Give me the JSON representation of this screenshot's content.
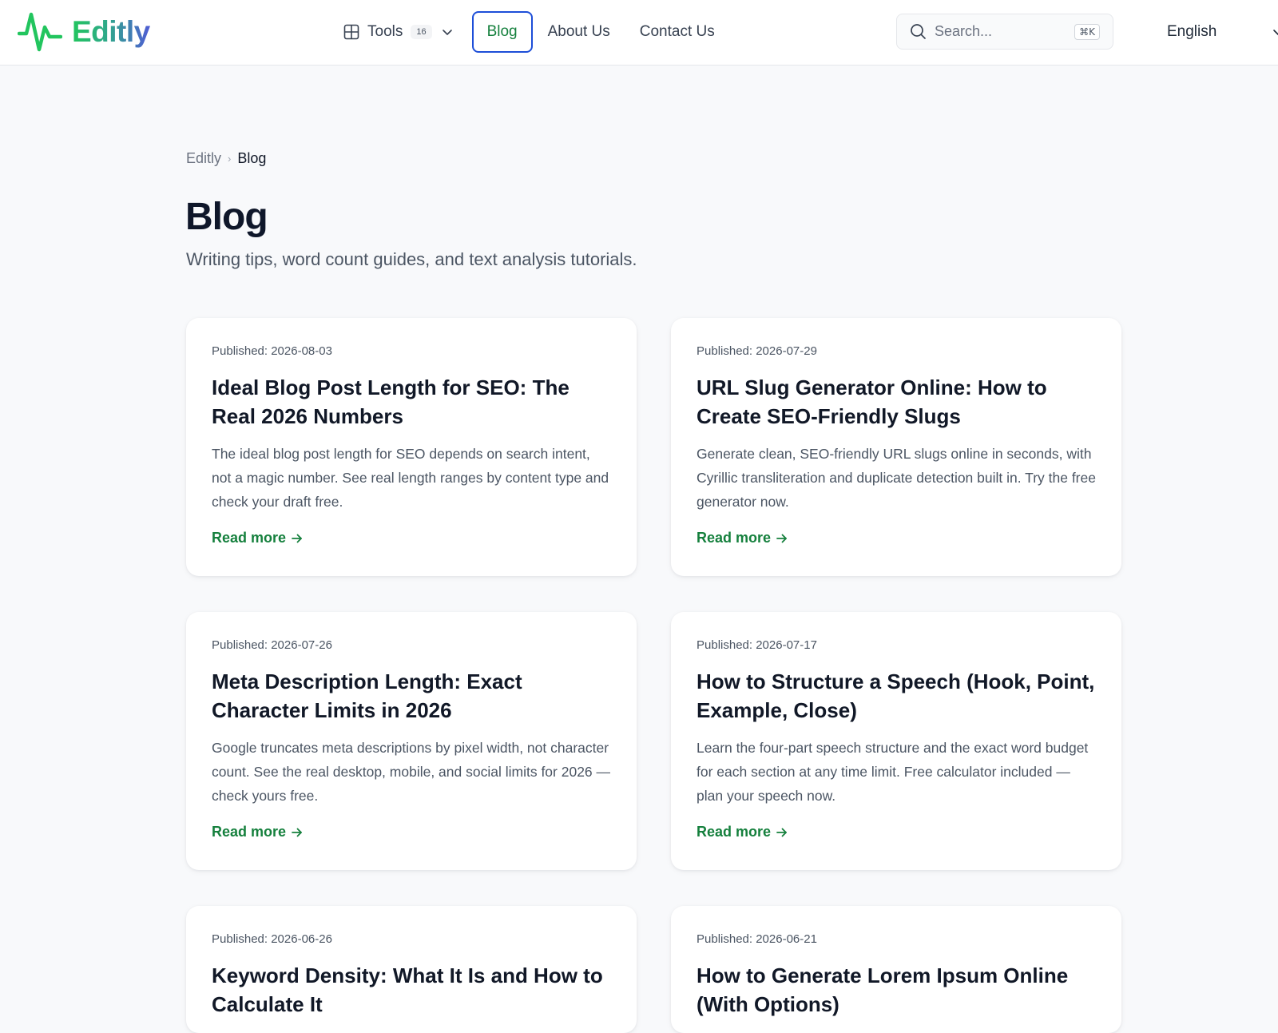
{
  "brand": {
    "name": "Editly",
    "colors": {
      "green": "#22c55e",
      "indigo": "#4f5bd5",
      "link": "#15803d",
      "focus": "#1d4ed8"
    }
  },
  "nav": {
    "tools_label": "Tools",
    "tools_badge": "16",
    "blog_label": "Blog",
    "about_label": "About Us",
    "contact_label": "Contact Us"
  },
  "search": {
    "placeholder": "Search...",
    "shortcut": "⌘K"
  },
  "language": {
    "selected": "English"
  },
  "breadcrumb": {
    "root": "Editly",
    "current": "Blog"
  },
  "page": {
    "title": "Blog",
    "subtitle": "Writing tips, word count guides, and text analysis tutorials."
  },
  "posts": [
    {
      "date": "Published: 2026-08-03",
      "title": "Ideal Blog Post Length for SEO: The Real 2026 Numbers",
      "description": "The ideal blog post length for SEO depends on search intent, not a magic number. See real length ranges by content type and check your draft free.",
      "link": "Read more"
    },
    {
      "date": "Published: 2026-07-29",
      "title": "URL Slug Generator Online: How to Create SEO-Friendly Slugs",
      "description": "Generate clean, SEO-friendly URL slugs online in seconds, with Cyrillic transliteration and duplicate detection built in. Try the free generator now.",
      "link": "Read more"
    },
    {
      "date": "Published: 2026-07-26",
      "title": "Meta Description Length: Exact Character Limits in 2026",
      "description": "Google truncates meta descriptions by pixel width, not character count. See the real desktop, mobile, and social limits for 2026 — check yours free.",
      "link": "Read more"
    },
    {
      "date": "Published: 2026-07-17",
      "title": "How to Structure a Speech (Hook, Point, Example, Close)",
      "description": "Learn the four-part speech structure and the exact word budget for each section at any time limit. Free calculator included — plan your speech now.",
      "link": "Read more"
    },
    {
      "date": "Published: 2026-06-26",
      "title": "Keyword Density: What It Is and How to Calculate It",
      "description": "",
      "link": ""
    },
    {
      "date": "Published: 2026-06-21",
      "title": "How to Generate Lorem Ipsum Online (With Options)",
      "description": "",
      "link": ""
    }
  ]
}
